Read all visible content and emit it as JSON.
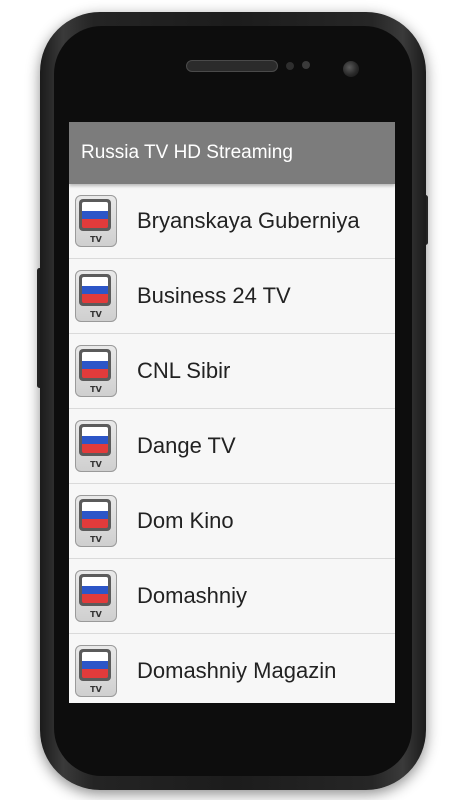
{
  "app": {
    "title": "Russia TV HD Streaming"
  },
  "channels": [
    {
      "name": "Bryanskaya Guberniya",
      "badge": "TV"
    },
    {
      "name": "Business 24 TV",
      "badge": "TV"
    },
    {
      "name": "CNL Sibir",
      "badge": "TV"
    },
    {
      "name": "Dange TV",
      "badge": "TV"
    },
    {
      "name": "Dom Kino",
      "badge": "TV"
    },
    {
      "name": "Domashniy",
      "badge": "TV"
    },
    {
      "name": "Domashniy Magazin",
      "badge": "TV"
    }
  ],
  "icon": {
    "name": "russia-flag-tv-icon"
  },
  "colors": {
    "app_bar": "#7c7c7c",
    "flag_white": "#ffffff",
    "flag_blue": "#2d56c8",
    "flag_red": "#e23b3b"
  }
}
